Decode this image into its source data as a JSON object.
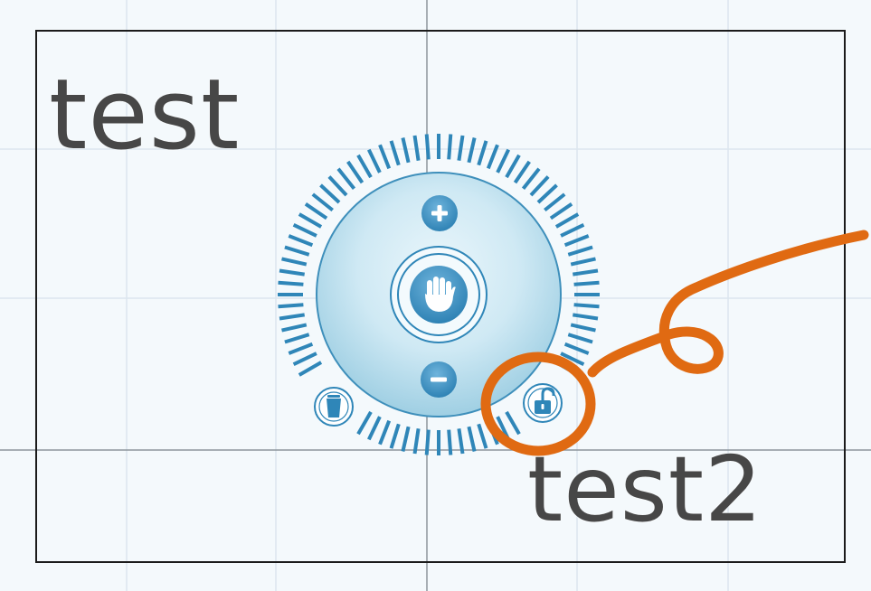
{
  "canvas": {
    "labels": [
      {
        "text": "test"
      },
      {
        "text": "test2"
      }
    ]
  },
  "navigation_widget": {
    "controls": [
      {
        "name": "zoom-in",
        "icon": "plus-icon",
        "symbol": "+"
      },
      {
        "name": "pan",
        "icon": "hand-icon"
      },
      {
        "name": "zoom-out",
        "icon": "minus-icon",
        "symbol": "−"
      },
      {
        "name": "delete",
        "icon": "trash-icon"
      },
      {
        "name": "lock",
        "icon": "lock-icon",
        "highlighted": true
      }
    ]
  },
  "colors": {
    "background": "#f4f9fc",
    "grid_line": "#dbe6ee",
    "axis_line": "#8d969c",
    "frame_border": "#1b1b1b",
    "label_text": "#474747",
    "widget_blue": "#2f86b8",
    "widget_light": "#bfe0ee",
    "annotation_orange": "#e06a12"
  }
}
